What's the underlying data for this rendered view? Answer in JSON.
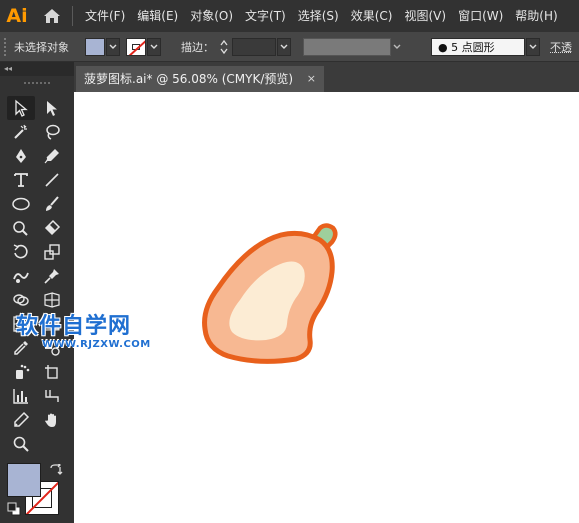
{
  "app": {
    "logo_text": "Ai"
  },
  "menu": {
    "items": [
      "文件(F)",
      "编辑(E)",
      "对象(O)",
      "文字(T)",
      "选择(S)",
      "效果(C)",
      "视图(V)",
      "窗口(W)",
      "帮助(H)"
    ]
  },
  "control_bar": {
    "selection_label": "未选择对象",
    "stroke_label": "描边：",
    "fill_color": "#a8b4d3",
    "profile_value": "● 5 点圆形",
    "opacity_label": "不透"
  },
  "document_tab": {
    "title": "菠萝图标.ai* @ 56.08% (CMYK/预览)",
    "close_glyph": "×"
  },
  "tool_panel": {
    "collapse_glyph": "◂◂"
  },
  "artwork": {
    "outer_color": "#e8601c",
    "body_color": "#f7b892",
    "highlight_color": "#fcecd4",
    "stem_color": "#9ecf9c"
  },
  "watermark": {
    "title": "软件自学网",
    "url": "WWW.RJZXW.COM"
  }
}
